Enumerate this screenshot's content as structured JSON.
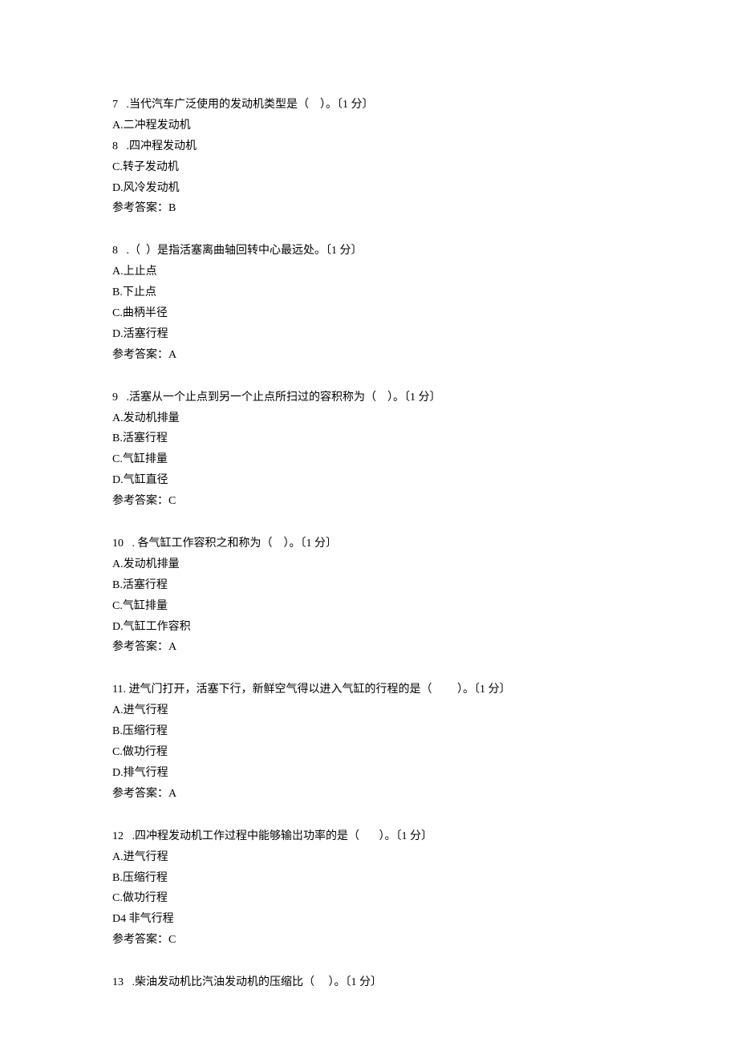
{
  "questions": [
    {
      "stem": "7   .当代汽车广泛使用的发动机类型是（    ）。〔1 分〕",
      "options": [
        "A.二冲程发动机",
        "8   .四冲程发动机",
        "C.转子发动机",
        "D.风冷发动机"
      ],
      "answer": "参考答案：B"
    },
    {
      "stem": "8   .（  ）是指活塞离曲轴回转中心最远处。〔1 分〕",
      "options": [
        "A.上止点",
        "B.下止点",
        "C.曲柄半径",
        "D.活塞行程"
      ],
      "answer": "参考答案：A"
    },
    {
      "stem": "9   .活塞从一个止点到另一个止点所扫过的容积称为（    ）。〔1 分〕",
      "options": [
        "A.发动机排量",
        "B.活塞行程",
        "C.气缸排量",
        "D.气缸直径"
      ],
      "answer": "参考答案：C"
    },
    {
      "stem": "10   . 各气缸工作容积之和称为（    ）。〔1 分〕",
      "options": [
        "A.发动机排量",
        "B.活塞行程",
        "C.气缸排量",
        "D.气缸工作容积"
      ],
      "answer": "参考答案：A"
    },
    {
      "stem": "11. 进气门打开，活塞下行，新鲜空气得以进入气缸的行程的是（         ）。〔1 分〕",
      "options": [
        "A.进气行程",
        "B.压缩行程",
        "C.做功行程",
        "D.排气行程"
      ],
      "answer": "参考答案：A"
    },
    {
      "stem": "12   .四冲程发动机工作过程中能够输岀功率的是（       ）。〔1 分〕",
      "options": [
        "A.进气行程",
        "B.压缩行程",
        "C.做功行程",
        "D4 非气行程"
      ],
      "answer": "参考答案：C"
    },
    {
      "stem": "13   .柴油发动机比汽油发动机的压缩比（     ）。〔1 分〕",
      "options": [],
      "answer": null
    }
  ]
}
